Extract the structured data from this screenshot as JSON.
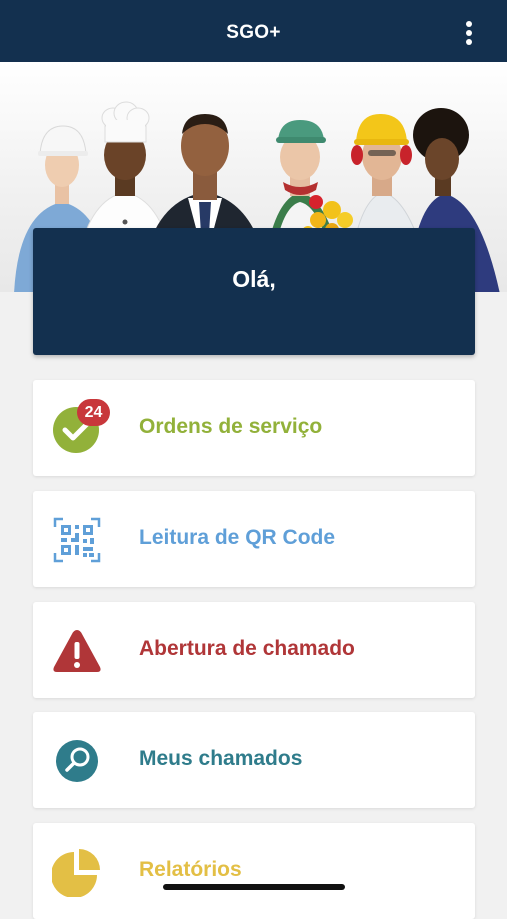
{
  "header": {
    "title": "SGO+",
    "menu_icon": "more-vert-icon"
  },
  "greeting": {
    "text": "Olá,"
  },
  "menu": {
    "items": [
      {
        "label": "Ordens de serviço",
        "icon": "check-circle-icon",
        "color": "#92b13a",
        "badge": "24"
      },
      {
        "label": "Leitura de QR Code",
        "icon": "qr-code-icon",
        "color": "#5f9fd8"
      },
      {
        "label": "Abertura de chamado",
        "icon": "warning-icon",
        "color": "#b03638"
      },
      {
        "label": "Meus chamados",
        "icon": "search-icon",
        "color": "#2f7c8b"
      },
      {
        "label": "Relatórios",
        "icon": "pie-chart-icon",
        "color": "#e3bf45"
      }
    ]
  },
  "colors": {
    "primary": "#13304f",
    "badge": "#c8373b",
    "background": "#f1f1f1"
  }
}
